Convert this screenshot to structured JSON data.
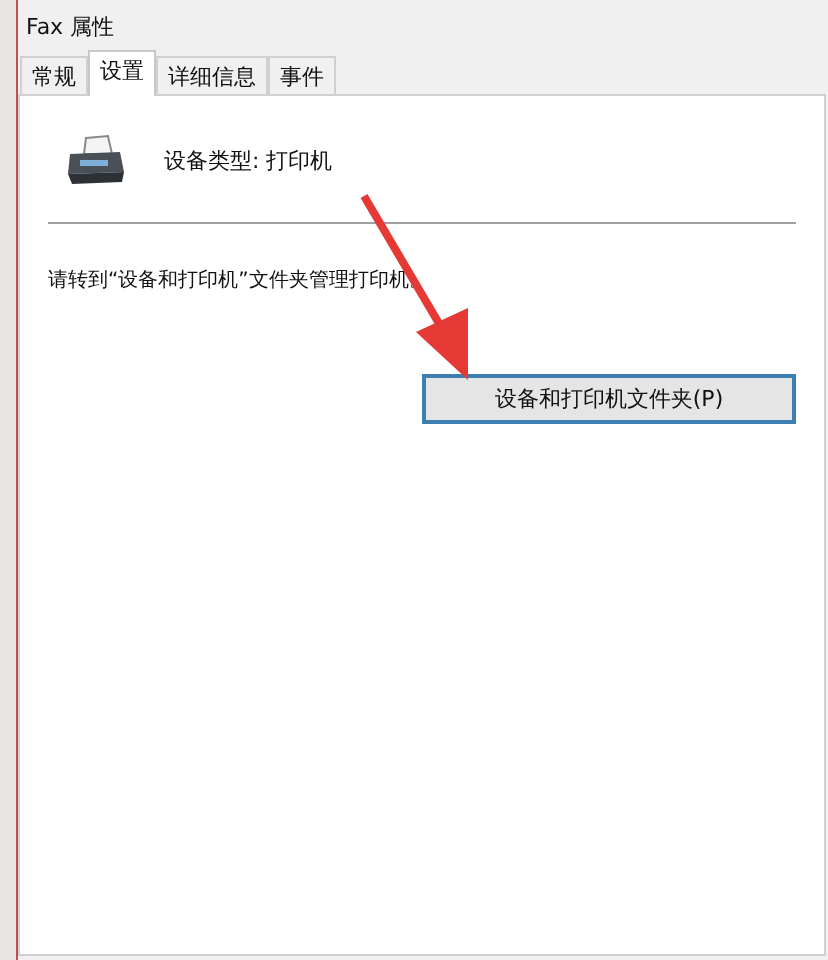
{
  "window": {
    "title": "Fax 属性"
  },
  "tabs": [
    {
      "label": "常规",
      "selected": false
    },
    {
      "label": "设置",
      "selected": true
    },
    {
      "label": "详细信息",
      "selected": false
    },
    {
      "label": "事件",
      "selected": false
    }
  ],
  "device_type": "设备类型: 打印机",
  "message": "请转到“设备和打印机”文件夹管理打印机。",
  "button": "设备和打印机文件夹(P)"
}
